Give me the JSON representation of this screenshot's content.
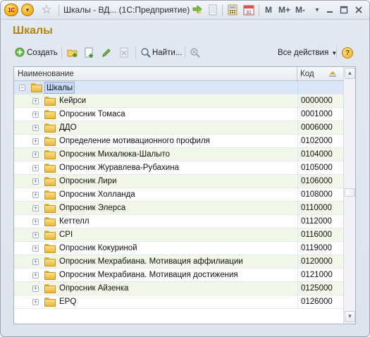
{
  "window": {
    "title": "Шкалы - ВД... (1С:Предприятие)",
    "logo_text": "1С",
    "m_label": "M",
    "mplus_label": "M+",
    "mminus_label": "M-"
  },
  "page": {
    "heading": "Шкалы"
  },
  "toolbar": {
    "create_label": "Создать",
    "find_label": "Найти...",
    "all_actions_label": "Все действия",
    "help_label": "?"
  },
  "table": {
    "columns": [
      "Наименование",
      "Код"
    ],
    "root": {
      "name": "Шкалы",
      "code": ""
    },
    "rows": [
      {
        "name": "Кейрси",
        "code": "0000000"
      },
      {
        "name": "Опросник Томаса",
        "code": "0001000"
      },
      {
        "name": "ДДО",
        "code": "0006000"
      },
      {
        "name": "Определение мотивационного профиля",
        "code": "0102000"
      },
      {
        "name": "Опросник Михалюка-Шалыто",
        "code": "0104000"
      },
      {
        "name": "Опросник Журавлева-Рубахина",
        "code": "0105000"
      },
      {
        "name": "Опросник Лири",
        "code": "0106000"
      },
      {
        "name": "Опросник Холланда",
        "code": "0108000"
      },
      {
        "name": "Опросник Элерса",
        "code": "0110000"
      },
      {
        "name": "Кеттелл",
        "code": "0112000"
      },
      {
        "name": "CPI",
        "code": "0116000"
      },
      {
        "name": "Опросник Кокуриной",
        "code": "0119000"
      },
      {
        "name": "Опросник Мехрабиана. Мотивация аффилиации",
        "code": "0120000"
      },
      {
        "name": "Опросник Мехрабиана. Мотивация достижения",
        "code": "0121000"
      },
      {
        "name": "Опросник Айзенка",
        "code": "0125000"
      },
      {
        "name": "EPQ",
        "code": "0126000"
      }
    ]
  },
  "colors": {
    "heading": "#b58506",
    "row_alt": "#f2f7ea",
    "selection": "#dbe7f8"
  }
}
